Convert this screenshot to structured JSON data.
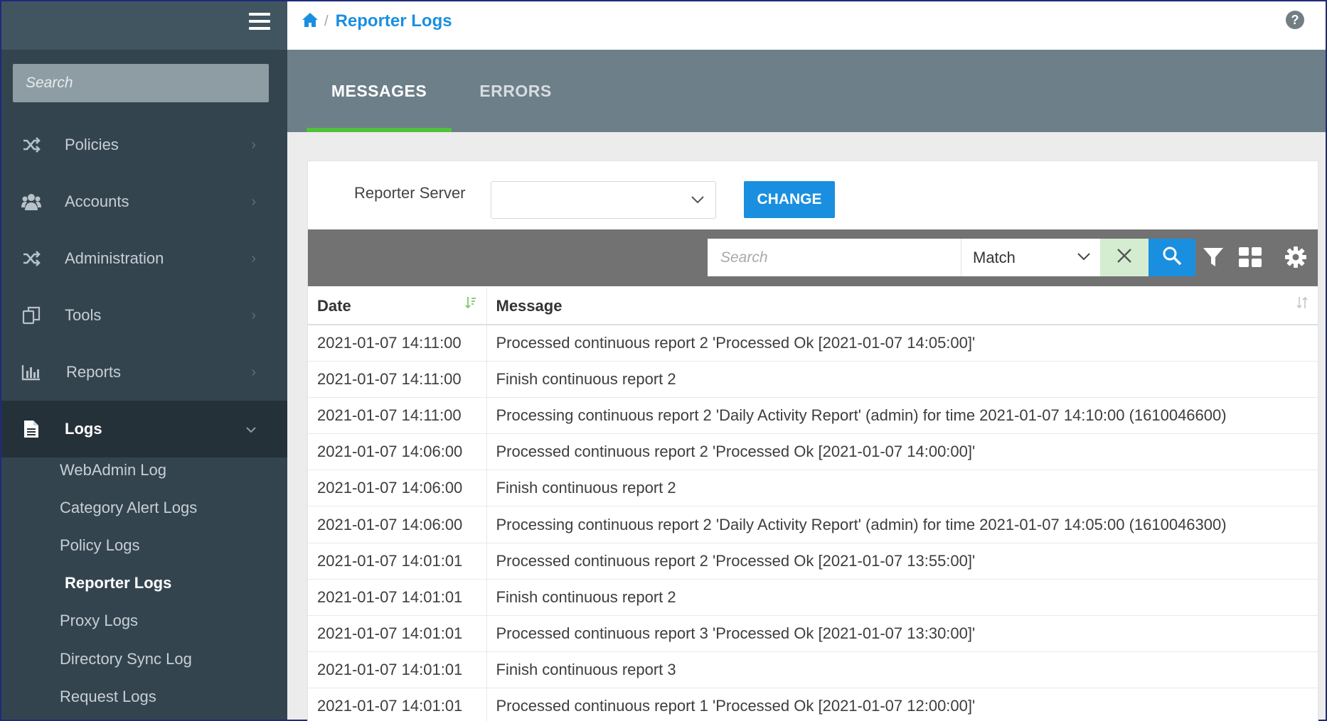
{
  "sidebar": {
    "search_placeholder": "Search",
    "nav": [
      {
        "label": "Policies",
        "icon": "shuffle-icon"
      },
      {
        "label": "Accounts",
        "icon": "users-icon"
      },
      {
        "label": "Administration",
        "icon": "shuffle-icon"
      },
      {
        "label": "Tools",
        "icon": "copy-icon"
      },
      {
        "label": "Reports",
        "icon": "bar-chart-icon"
      },
      {
        "label": "Logs",
        "icon": "document-icon",
        "active": true
      }
    ],
    "chevron": "›",
    "logs_sub": [
      {
        "label": "WebAdmin Log"
      },
      {
        "label": "Category Alert Logs"
      },
      {
        "label": "Policy Logs"
      },
      {
        "label": "Reporter Logs",
        "current": true
      },
      {
        "label": "Proxy Logs"
      },
      {
        "label": "Directory Sync Log"
      },
      {
        "label": "Request Logs"
      }
    ]
  },
  "header": {
    "separator": "/",
    "title": "Reporter Logs",
    "help": "?"
  },
  "tabs": {
    "messages": "MESSAGES",
    "errors": "ERRORS"
  },
  "server": {
    "label": "Reporter Server",
    "selected": "",
    "change_label": "CHANGE"
  },
  "toolbar": {
    "search_placeholder": "Search",
    "match_value": "Match"
  },
  "table": {
    "columns": [
      "Date",
      "Message"
    ],
    "rows": [
      [
        "2021-01-07 14:11:00",
        "Processed continuous report 2 'Processed Ok [2021-01-07 14:05:00]'"
      ],
      [
        "2021-01-07 14:11:00",
        "Finish continuous report 2"
      ],
      [
        "2021-01-07 14:11:00",
        "Processing continuous report 2 'Daily Activity Report' (admin) for time 2021-01-07 14:10:00 (1610046600)"
      ],
      [
        "2021-01-07 14:06:00",
        "Processed continuous report 2 'Processed Ok [2021-01-07 14:00:00]'"
      ],
      [
        "2021-01-07 14:06:00",
        "Finish continuous report 2"
      ],
      [
        "2021-01-07 14:06:00",
        "Processing continuous report 2 'Daily Activity Report' (admin) for time 2021-01-07 14:05:00 (1610046300)"
      ],
      [
        "2021-01-07 14:01:01",
        "Processed continuous report 2 'Processed Ok [2021-01-07 13:55:00]'"
      ],
      [
        "2021-01-07 14:01:01",
        "Finish continuous report 2"
      ],
      [
        "2021-01-07 14:01:01",
        "Processed continuous report 3 'Processed Ok [2021-01-07 13:30:00]'"
      ],
      [
        "2021-01-07 14:01:01",
        "Finish continuous report 3"
      ],
      [
        "2021-01-07 14:01:01",
        "Processed continuous report 1 'Processed Ok [2021-01-07 12:00:00]'"
      ]
    ]
  },
  "colors": {
    "accent": "#1a8fe0",
    "sidebar_bg": "#34444f",
    "tab_underline": "#4fc13a"
  }
}
